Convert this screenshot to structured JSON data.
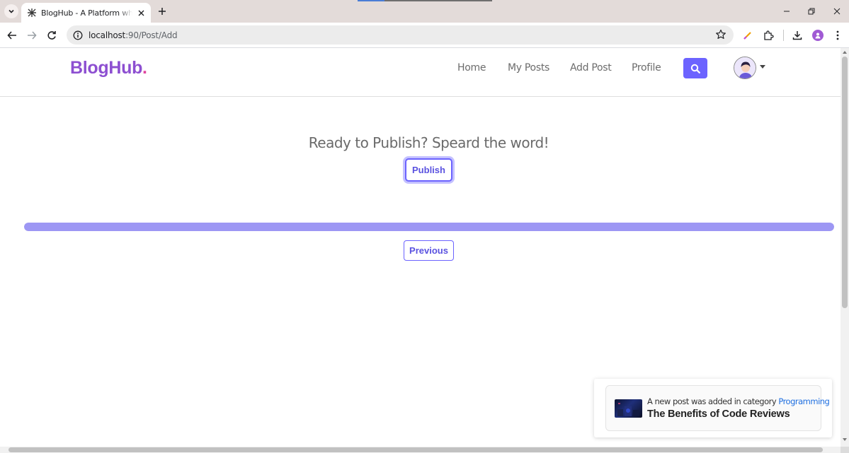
{
  "browser": {
    "tab": {
      "title": "BlogHub - A Platform where you",
      "favicon": "bloghub-favicon-icon"
    },
    "address_bar": {
      "host": "localhost",
      "path": ":90/Post/Add"
    },
    "icons": [
      "tab-search-icon",
      "close-icon",
      "plus-icon",
      "minimize-icon",
      "restore-icon",
      "back-icon",
      "forward-icon",
      "reload-icon",
      "info-icon",
      "star-icon",
      "pen-icon",
      "extensions-icon",
      "download-icon",
      "profile-icon",
      "more-icon"
    ]
  },
  "site": {
    "brand": "BlogHub",
    "brand_dot": ".",
    "nav": {
      "home": "Home",
      "my_posts": "My Posts",
      "add_post": "Add Post",
      "profile": "Profile"
    },
    "colors": {
      "brand": "#8d4fd1",
      "accent": "#6c63ff",
      "progress": "#9d97f4",
      "link": "#1f6fe0"
    }
  },
  "main": {
    "ready_text": "Ready to Publish? Speard the word!",
    "publish_label": "Publish",
    "previous_label": "Previous",
    "progress_percent": 100
  },
  "toast": {
    "message_prefix": "A new post was added in category",
    "category": "Programming",
    "post_title": "The Benefits of Code Reviews"
  }
}
